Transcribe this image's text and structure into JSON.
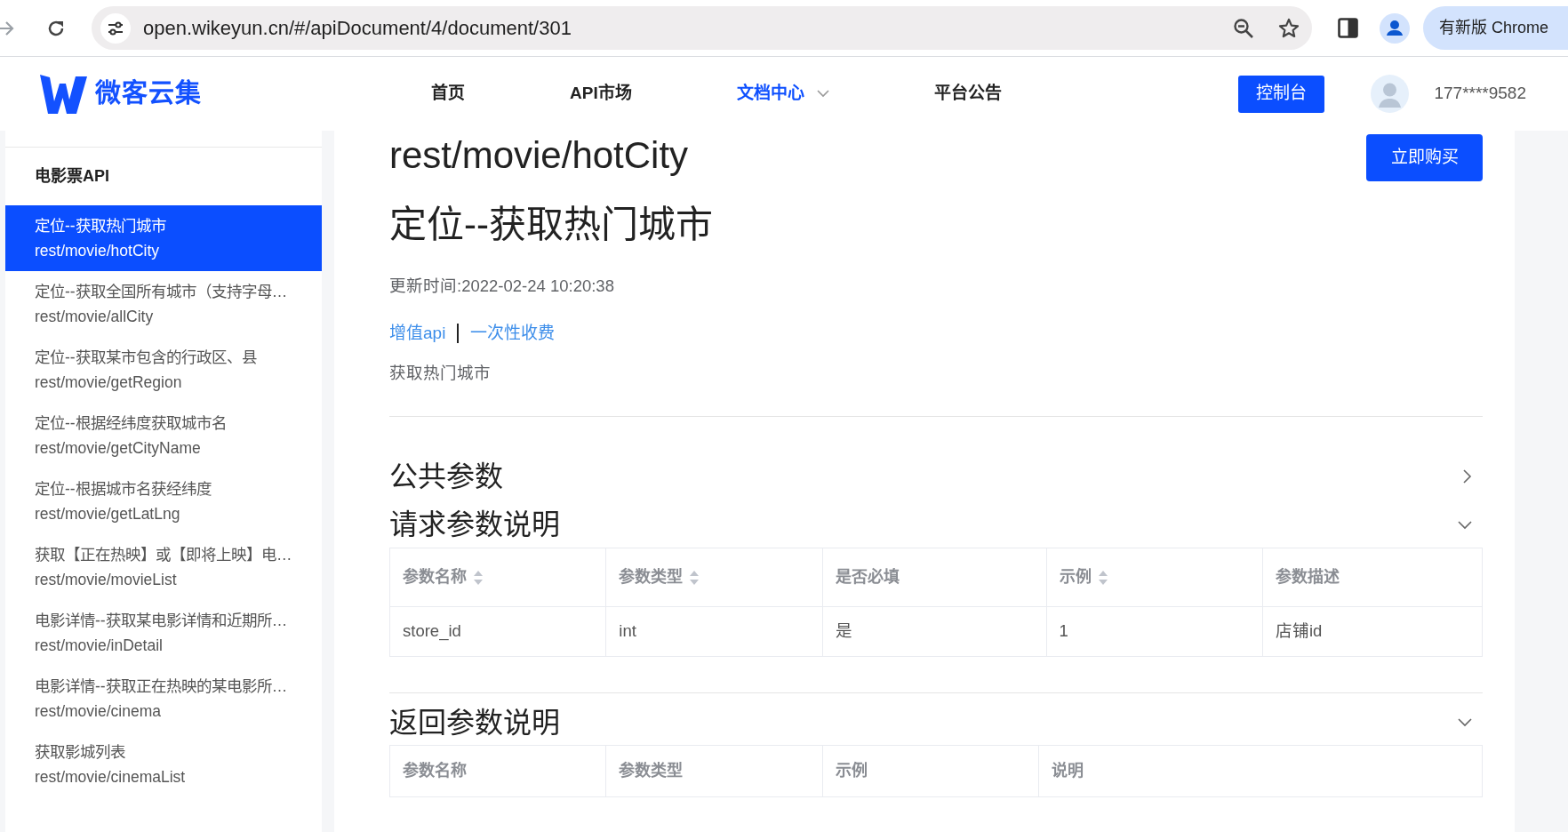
{
  "browser": {
    "url": "open.wikeyun.cn/#/apiDocument/4/document/301",
    "update_notice": "有新版 Chrome"
  },
  "header": {
    "logo_text": "微客云集",
    "nav": [
      {
        "label": "首页",
        "selected": false,
        "dropdown": false
      },
      {
        "label": "API市场",
        "selected": false,
        "dropdown": false
      },
      {
        "label": "文档中心",
        "selected": true,
        "dropdown": true
      },
      {
        "label": "平台公告",
        "selected": false,
        "dropdown": false
      }
    ],
    "console_button": "控制台",
    "user": "177****9582"
  },
  "sidebar": {
    "group": "电影票API",
    "items": [
      {
        "title": "定位--获取热门城市",
        "path": "rest/movie/hotCity",
        "selected": true
      },
      {
        "title": "定位--获取全国所有城市（支持字母…",
        "path": "rest/movie/allCity",
        "selected": false
      },
      {
        "title": "定位--获取某市包含的行政区、县",
        "path": "rest/movie/getRegion",
        "selected": false
      },
      {
        "title": "定位--根据经纬度获取城市名",
        "path": "rest/movie/getCityName",
        "selected": false
      },
      {
        "title": "定位--根据城市名获经纬度",
        "path": "rest/movie/getLatLng",
        "selected": false
      },
      {
        "title": "获取【正在热映】或【即将上映】电…",
        "path": "rest/movie/movieList",
        "selected": false
      },
      {
        "title": "电影详情--获取某电影详情和近期所…",
        "path": "rest/movie/inDetail",
        "selected": false
      },
      {
        "title": "电影详情--获取正在热映的某电影所…",
        "path": "rest/movie/cinema",
        "selected": false
      },
      {
        "title": "获取影城列表",
        "path": "rest/movie/cinemaList",
        "selected": false
      }
    ]
  },
  "main": {
    "path_title": "rest/movie/hotCity",
    "title": "定位--获取热门城市",
    "buy_button": "立即购买",
    "updated": "更新时间:2022-02-24 10:20:38",
    "tags": [
      "增值api",
      "一次性收费"
    ],
    "description": "获取热门城市",
    "sections": [
      {
        "title": "公共参数",
        "expanded": false
      },
      {
        "title": "请求参数说明",
        "expanded": true,
        "table": {
          "columns": [
            {
              "label": "参数名称",
              "sortable": true
            },
            {
              "label": "参数类型",
              "sortable": true
            },
            {
              "label": "是否必填",
              "sortable": false
            },
            {
              "label": "示例",
              "sortable": true
            },
            {
              "label": "参数描述",
              "sortable": false
            }
          ],
          "rows": [
            [
              "store_id",
              "int",
              "是",
              "1",
              "店铺id"
            ]
          ]
        }
      },
      {
        "title": "返回参数说明",
        "expanded": true,
        "table": {
          "columns": [
            {
              "label": "参数名称",
              "sortable": false
            },
            {
              "label": "参数类型",
              "sortable": false
            },
            {
              "label": "示例",
              "sortable": false
            },
            {
              "label": "说明",
              "sortable": false
            }
          ]
        }
      }
    ]
  }
}
